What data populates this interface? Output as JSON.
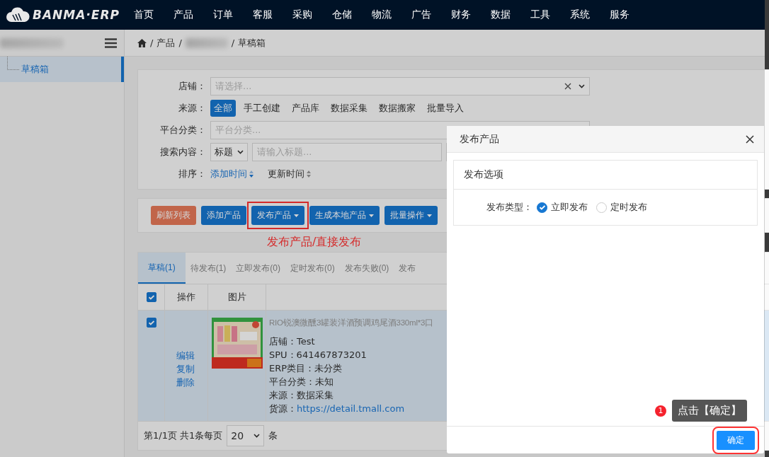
{
  "brand": "BANMA·ERP",
  "nav": [
    "首页",
    "产品",
    "订单",
    "客服",
    "采购",
    "仓储",
    "物流",
    "广告",
    "财务",
    "数据",
    "工具",
    "系统",
    "服务"
  ],
  "sidebar": {
    "items": [
      {
        "label": "草稿箱",
        "selected": true
      }
    ]
  },
  "breadcrumb": {
    "separator": "/",
    "items": [
      {
        "kind": "text",
        "label": "产品"
      },
      {
        "kind": "redacted"
      },
      {
        "kind": "text",
        "label": "草稿箱"
      }
    ]
  },
  "filters": {
    "store": {
      "label": "店铺：",
      "placeholder": "请选择..."
    },
    "source": {
      "label": "来源：",
      "options": [
        {
          "label": "全部",
          "selected": true
        },
        {
          "label": "手工创建",
          "selected": false
        },
        {
          "label": "产品库",
          "selected": false
        },
        {
          "label": "数据采集",
          "selected": false
        },
        {
          "label": "数据搬家",
          "selected": false
        },
        {
          "label": "批量导入",
          "selected": false
        }
      ]
    },
    "platform_category": {
      "label": "平台分类：",
      "placeholder": "平台分类..."
    },
    "search": {
      "label": "搜索内容：",
      "field_select": "标题",
      "placeholder": "请输入标题..."
    },
    "sort": {
      "label": "排序：",
      "options": [
        {
          "label": "添加时间",
          "selected": true
        },
        {
          "label": "更新时间",
          "selected": false
        }
      ]
    }
  },
  "toolbar": [
    {
      "label": "刷新列表",
      "kind": "danger",
      "dropdown": false,
      "highlighted": false
    },
    {
      "label": "添加产品",
      "kind": "primary",
      "dropdown": false,
      "highlighted": false
    },
    {
      "label": "发布产品",
      "kind": "primary",
      "dropdown": true,
      "highlighted": true
    },
    {
      "label": "生成本地产品",
      "kind": "primary",
      "dropdown": true,
      "highlighted": false
    },
    {
      "label": "批量操作",
      "kind": "primary",
      "dropdown": true,
      "highlighted": false
    }
  ],
  "annotation_caption": "发布产品/直接发布",
  "tabs": [
    {
      "label": "草稿(1)",
      "selected": true
    },
    {
      "label": "待发布(1)",
      "selected": false
    },
    {
      "label": "立即发布(0)",
      "selected": false
    },
    {
      "label": "定时发布(0)",
      "selected": false
    },
    {
      "label": "发布失败(0)",
      "selected": false
    },
    {
      "label": "发布",
      "selected": false
    }
  ],
  "table": {
    "select_all_checked": true,
    "columns": [
      "操作",
      "图片"
    ],
    "rows": [
      {
        "checked": true,
        "actions": [
          "编辑",
          "复制",
          "删除"
        ],
        "title": "RIO锐澳微醺3罐装洋酒预调鸡尾酒330ml*3口",
        "details": [
          {
            "label": "店铺：",
            "value": "Test",
            "kind": "text"
          },
          {
            "label": "SPU：",
            "value": "641467873201",
            "kind": "text"
          },
          {
            "label": "ERP类目：",
            "value": "未分类",
            "kind": "text"
          },
          {
            "label": "平台分类：",
            "value": "未知",
            "kind": "text"
          },
          {
            "label": "来源：",
            "value": "数据采集",
            "kind": "text"
          },
          {
            "label": "货源：",
            "value": "https://detail.tmall.com",
            "kind": "link"
          }
        ]
      }
    ]
  },
  "pagination": {
    "summary": "第1/1页 共1条每页",
    "page_size": "20",
    "unit": "条"
  },
  "modal": {
    "title": "发布产品",
    "section_title": "发布选项",
    "field_label": "发布类型：",
    "options": [
      {
        "label": "立即发布",
        "selected": true
      },
      {
        "label": "定时发布",
        "selected": false
      }
    ],
    "confirm": "确定",
    "tooltip": {
      "step": "1",
      "text": "点击【确定】"
    }
  }
}
